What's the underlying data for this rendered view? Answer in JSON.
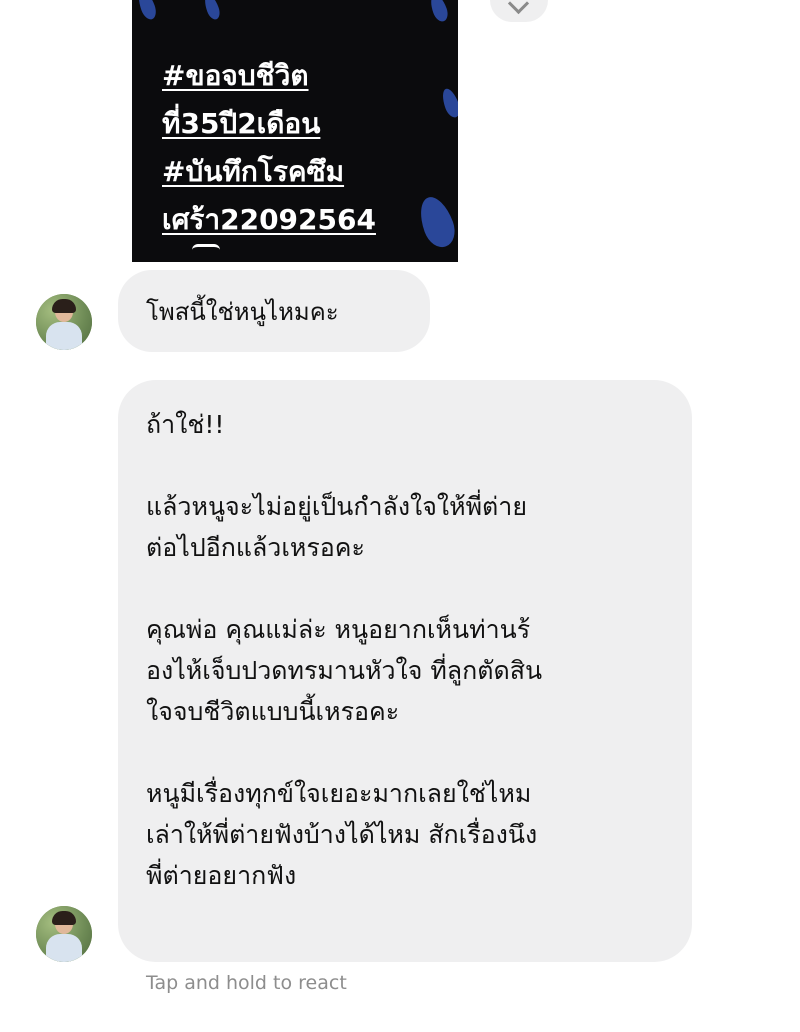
{
  "attachment": {
    "hashtags": [
      "#ขอจบชีวิต",
      "ที่35ปี2เดือน",
      "#บันทึกโรคซึม",
      "เศร้า22092564"
    ]
  },
  "messages": [
    {
      "text": "โพสนี้ใช่หนูไหมคะ"
    },
    {
      "lines": [
        "ถ้าใช่!!",
        "",
        "แล้วหนูจะไม่อยู่เป็นกำลังใจให้พี่ต่าย",
        "ต่อไปอีกแล้วเหรอคะ",
        "",
        "คุณพ่อ คุณแม่ล่ะ หนูอยากเห็นท่านร้",
        "องไห้เจ็บปวดทรมานหัวใจ ที่ลูกตัดสิน",
        "ใจจบชีวิตแบบนี้เหรอคะ",
        "",
        "หนูมีเรื่องทุกข์ใจเยอะมากเลยใช่ไหม",
        "เล่าให้พี่ต่ายฟังบ้างได้ไหม สักเรื่องนึง",
        "พี่ต่ายอยากฟัง"
      ]
    }
  ],
  "hint": "Tap and hold to react",
  "colors": {
    "bubble_bg": "#efeff0",
    "attachment_bg": "#0b0b0d",
    "hint_text": "#8d8d8d"
  },
  "icons": {
    "partial_top_right": "chevron-down-icon"
  }
}
